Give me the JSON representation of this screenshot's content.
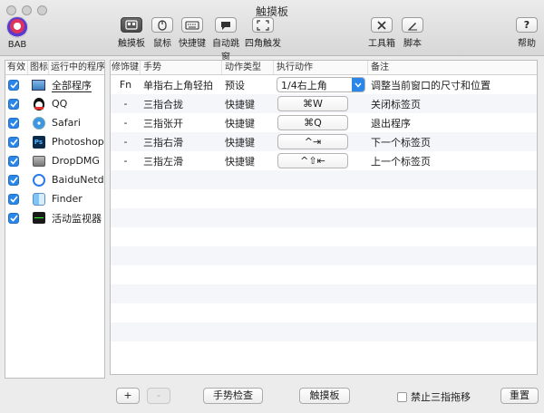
{
  "window": {
    "title": "触摸板"
  },
  "app": {
    "name": "BAB"
  },
  "toolbar": {
    "items": [
      {
        "label": "触摸板",
        "icon": "trackpad-icon"
      },
      {
        "label": "鼠标",
        "icon": "mouse-icon"
      },
      {
        "label": "快捷键",
        "icon": "keyboard-icon"
      },
      {
        "label": "自动跳窗",
        "icon": "speech-bubble-icon"
      },
      {
        "label": "四角触发",
        "icon": "corners-icon"
      }
    ],
    "tools_label": "工具箱",
    "script_label": "脚本",
    "help_label": "帮助"
  },
  "left_table": {
    "headers": [
      "有效",
      "图标",
      "运行中的程序"
    ],
    "rows": [
      {
        "name": "全部程序",
        "icon": "all-apps-icon",
        "checked": true
      },
      {
        "name": "QQ",
        "icon": "qq-icon",
        "checked": true
      },
      {
        "name": "Safari",
        "icon": "safari-icon",
        "checked": true
      },
      {
        "name": "Photoshop",
        "icon": "photoshop-icon",
        "checked": true
      },
      {
        "name": "DropDMG",
        "icon": "dropdmg-icon",
        "checked": true
      },
      {
        "name": "BaiduNetdisk",
        "icon": "baidunetdisk-icon",
        "checked": true
      },
      {
        "name": "Finder",
        "icon": "finder-icon",
        "checked": true
      },
      {
        "name": "活动监视器",
        "icon": "activity-monitor-icon",
        "checked": true
      }
    ]
  },
  "right_table": {
    "headers": [
      "修饰键",
      "手势",
      "动作类型",
      "执行动作",
      "备注"
    ],
    "rows": [
      {
        "modifier": "Fn",
        "gesture": "单指右上角轻拍",
        "type": "预设",
        "action": "1/4右上角",
        "action_kind": "select",
        "note": "调整当前窗口的尺寸和位置"
      },
      {
        "modifier": "-",
        "gesture": "三指合拢",
        "type": "快捷键",
        "action": "⌘W",
        "action_kind": "key",
        "note": "关闭标签页"
      },
      {
        "modifier": "-",
        "gesture": "三指张开",
        "type": "快捷键",
        "action": "⌘Q",
        "action_kind": "key",
        "note": "退出程序"
      },
      {
        "modifier": "-",
        "gesture": "三指右滑",
        "type": "快捷键",
        "action": "^⇥",
        "action_kind": "key",
        "note": "下一个标签页"
      },
      {
        "modifier": "-",
        "gesture": "三指左滑",
        "type": "快捷键",
        "action": "^⇧⇤",
        "action_kind": "key",
        "note": "上一个标签页"
      }
    ]
  },
  "bottom": {
    "add_label": "+",
    "remove_label": "-",
    "gesture_check_label": "手势检查",
    "trackpad_label": "触摸板",
    "disable_drag_label": "禁止三指拖移",
    "reset_label": "重置"
  },
  "colors": {
    "accent": "#2a86e8",
    "toolbar_active": "#555555"
  }
}
